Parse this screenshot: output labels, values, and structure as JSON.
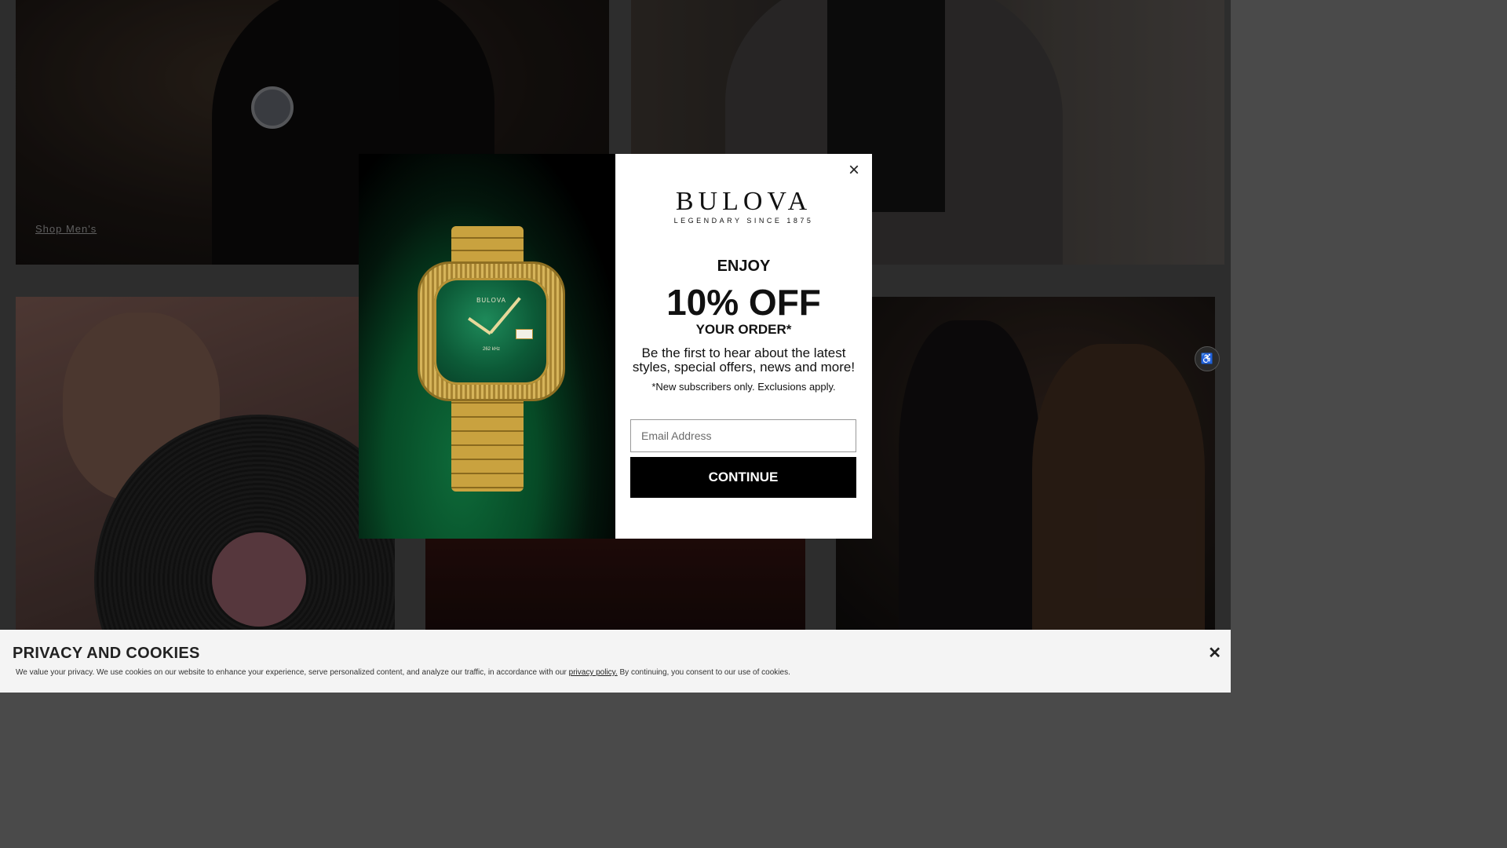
{
  "tiles": {
    "mens_link": "Shop Men's"
  },
  "accessibility": {
    "icon": "accessibility-icon",
    "glyph": "♿"
  },
  "popup": {
    "close_glyph": "×",
    "logo": {
      "word": "BULOVA",
      "tagline": "LEGENDARY SINCE 1875"
    },
    "product_image": {
      "watch_brand": "BULOVA",
      "watch_frequency": "262 kHz"
    },
    "enjoy": "ENJOY",
    "offer": "10% OFF",
    "your_order": "YOUR ORDER*",
    "blurb": "Be the first to hear about the latest styles, special offers, news and more!",
    "fine_print": "*New subscribers only. Exclusions apply.",
    "email_placeholder": "Email Address",
    "continue_label": "CONTINUE"
  },
  "cookie_banner": {
    "title": "PRIVACY AND COOKIES",
    "text_before": "We value your privacy. We use cookies on our website to enhance your experience, serve personalized content, and analyze our traffic, in accordance with our ",
    "link": "privacy policy.",
    "text_after": " By continuing, you consent to our use of cookies.",
    "close_glyph": "✕"
  }
}
